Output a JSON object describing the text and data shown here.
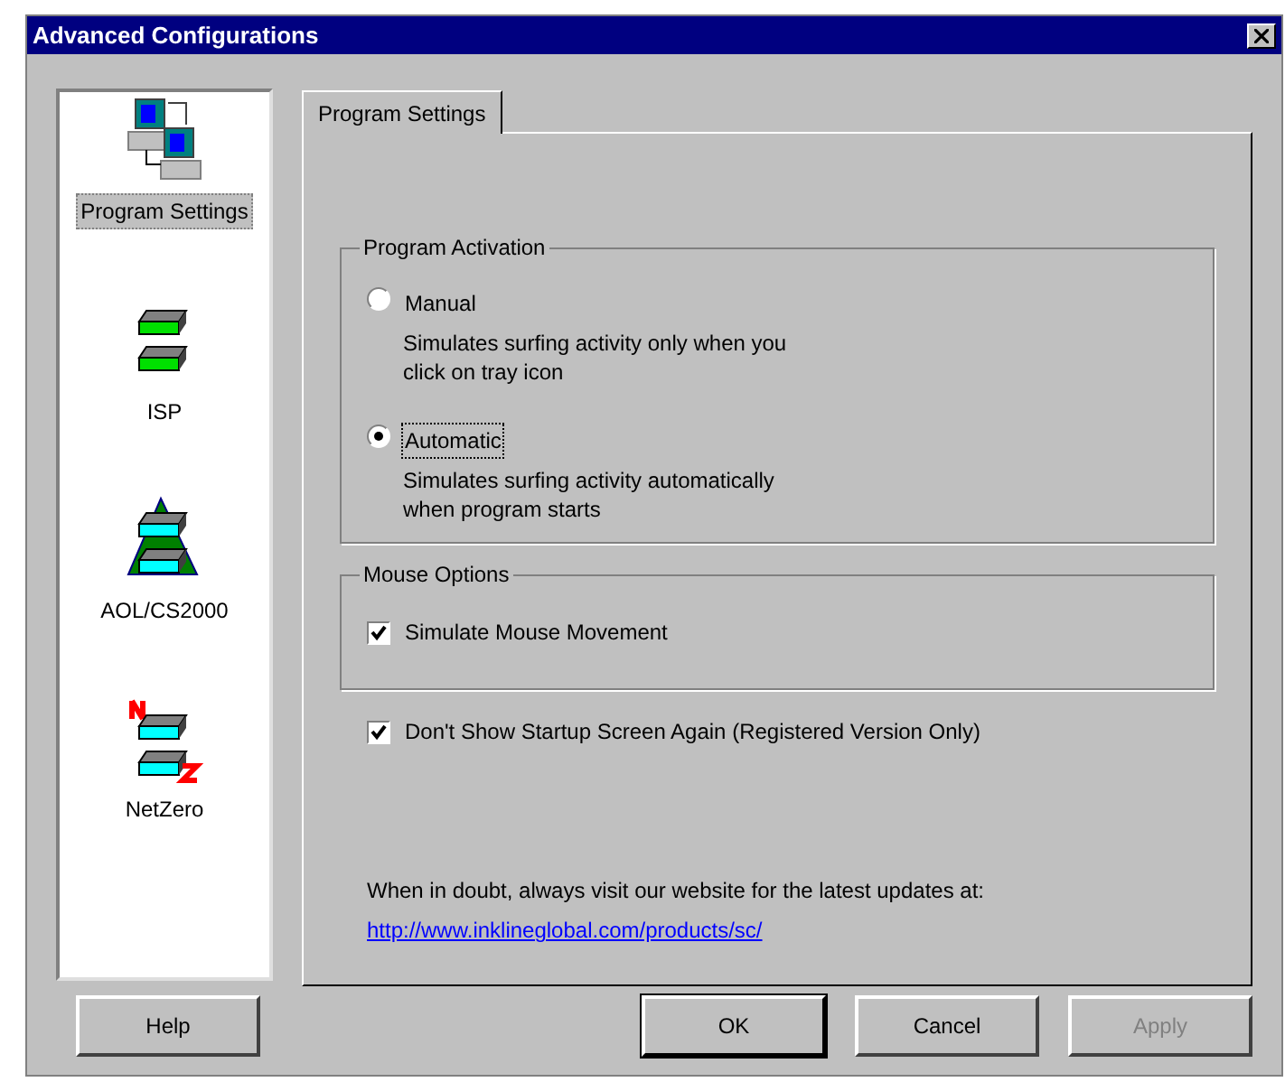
{
  "window": {
    "title": "Advanced Configurations"
  },
  "sidebar": {
    "items": [
      {
        "label": "Program Settings",
        "kind": "computers",
        "selected": true
      },
      {
        "label": "ISP",
        "kind": "isp",
        "selected": false
      },
      {
        "label": "AOL/CS2000",
        "kind": "aol",
        "selected": false
      },
      {
        "label": "NetZero",
        "kind": "netzero",
        "selected": false
      }
    ]
  },
  "tabs": [
    {
      "label": "Program Settings",
      "selected": true
    }
  ],
  "program_activation": {
    "title": "Program Activation",
    "options": [
      {
        "label": "Manual",
        "description": "Simulates surfing activity only when you\nclick on tray icon",
        "selected": false,
        "focused": false
      },
      {
        "label": "Automatic",
        "description": "Simulates surfing activity automatically\nwhen program starts",
        "selected": true,
        "focused": true
      }
    ]
  },
  "mouse_options": {
    "title": "Mouse Options",
    "checkboxes": [
      {
        "label": "Simulate Mouse Movement",
        "checked": true
      }
    ]
  },
  "startup_checkbox": {
    "label": "Don't Show Startup Screen Again (Registered Version Only)",
    "checked": true
  },
  "note": "When in doubt, always visit our website for the latest updates at:",
  "link": "http://www.inklineglobal.com/products/sc/",
  "help_button": {
    "label": "Help",
    "disabled": false
  },
  "buttons": [
    {
      "label": "OK",
      "disabled": false,
      "default": true
    },
    {
      "label": "Cancel",
      "disabled": false,
      "default": false
    },
    {
      "label": "Apply",
      "disabled": true,
      "default": false
    }
  ]
}
